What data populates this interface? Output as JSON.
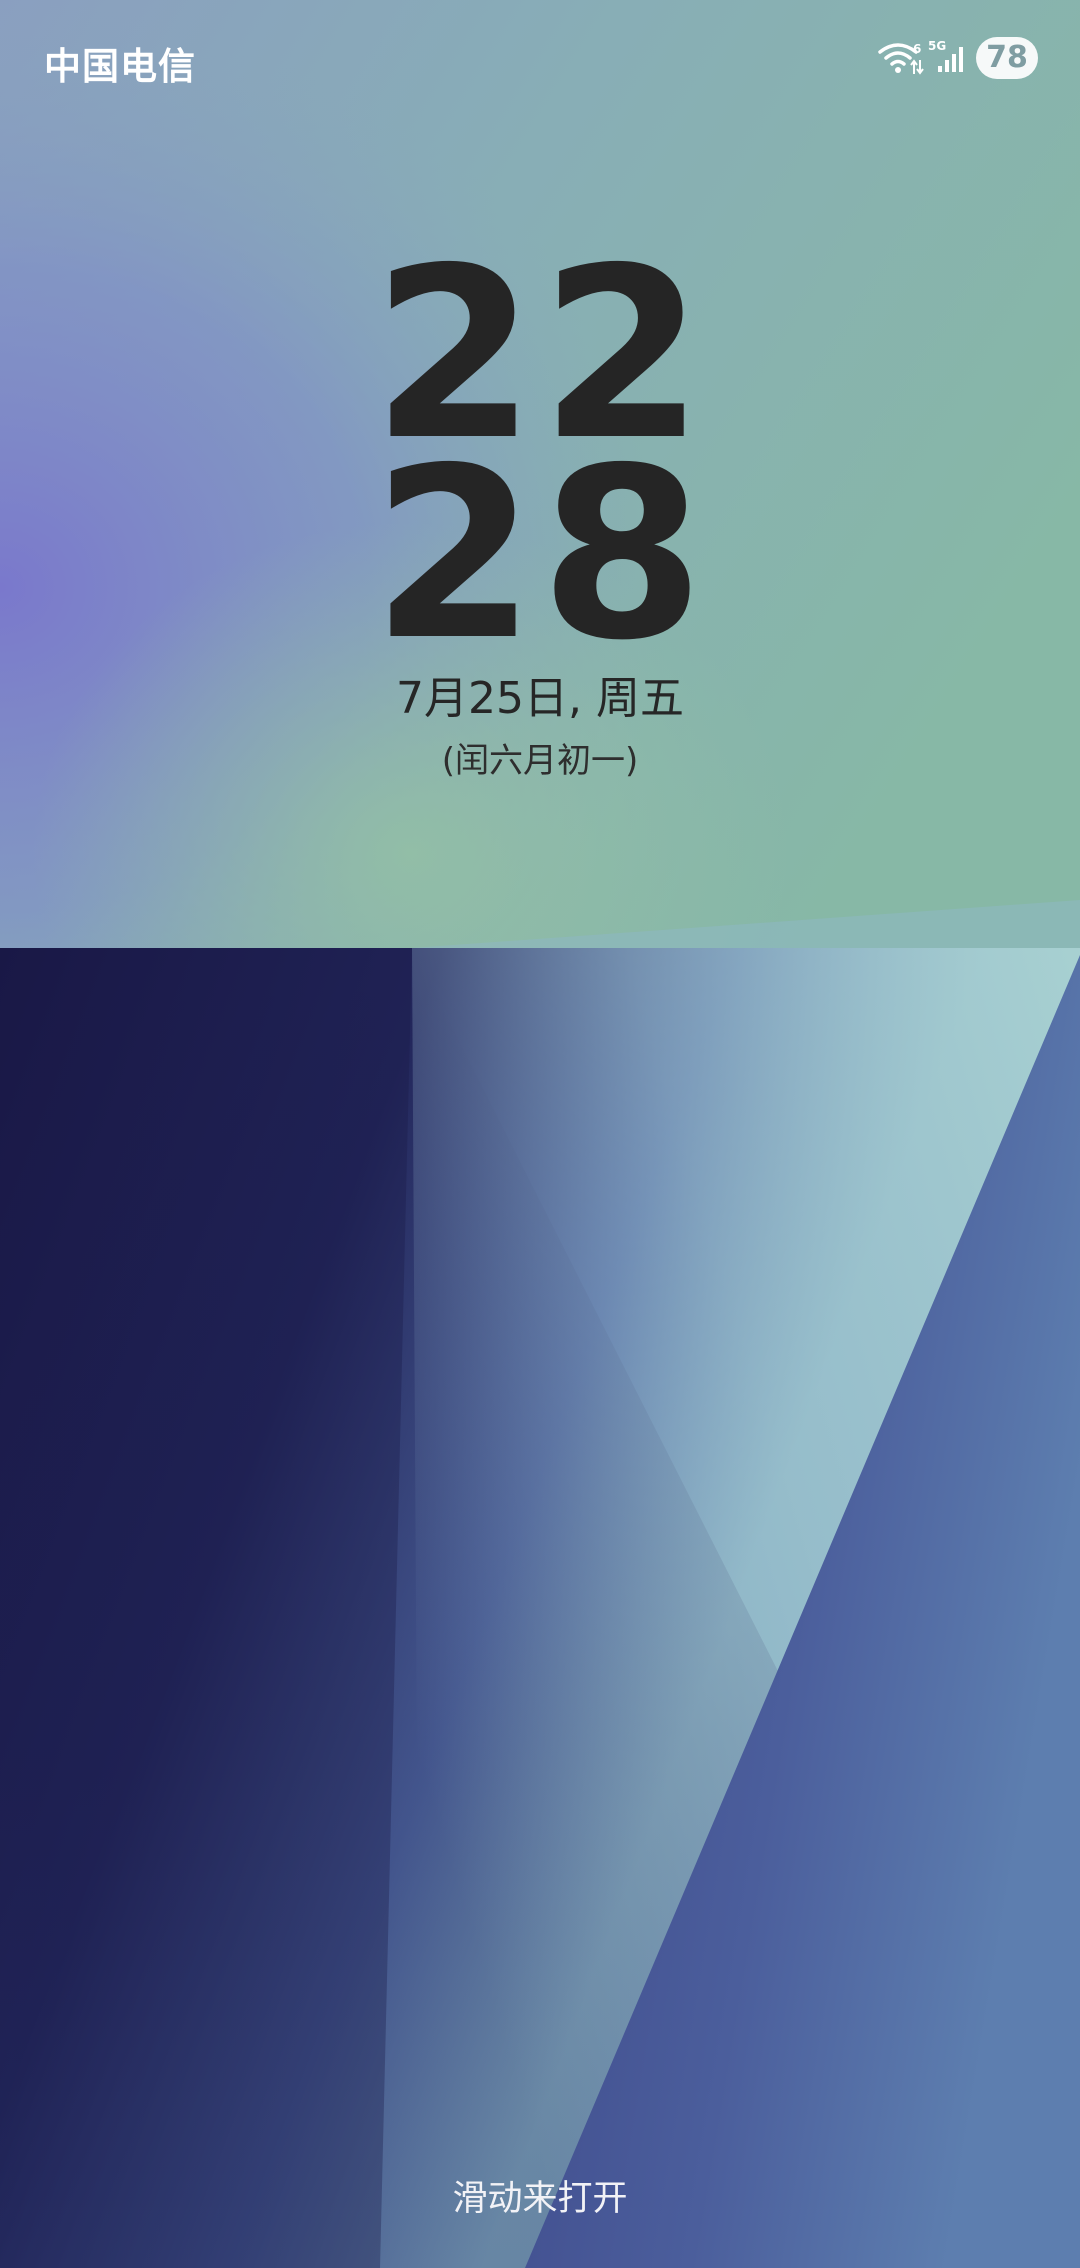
{
  "status_bar": {
    "carrier": "中国电信",
    "wifi_badge": "6",
    "network": "5G",
    "battery": "78"
  },
  "lock_screen": {
    "hour": "22",
    "minute": "28",
    "date": "7月25日, 周五",
    "lunar_date": "(闰六月初一)",
    "unlock_hint": "滑动来打开"
  },
  "icons": [
    "wifi-icon",
    "signal-icon"
  ],
  "colors": {
    "clock_text": "#252525",
    "wallpaper_top_green": "#8ab5a5",
    "wallpaper_left_purple": "#7a7fcb",
    "wallpaper_dark_navy": "#1b1a48",
    "wallpaper_right_blue": "#5470a8"
  }
}
